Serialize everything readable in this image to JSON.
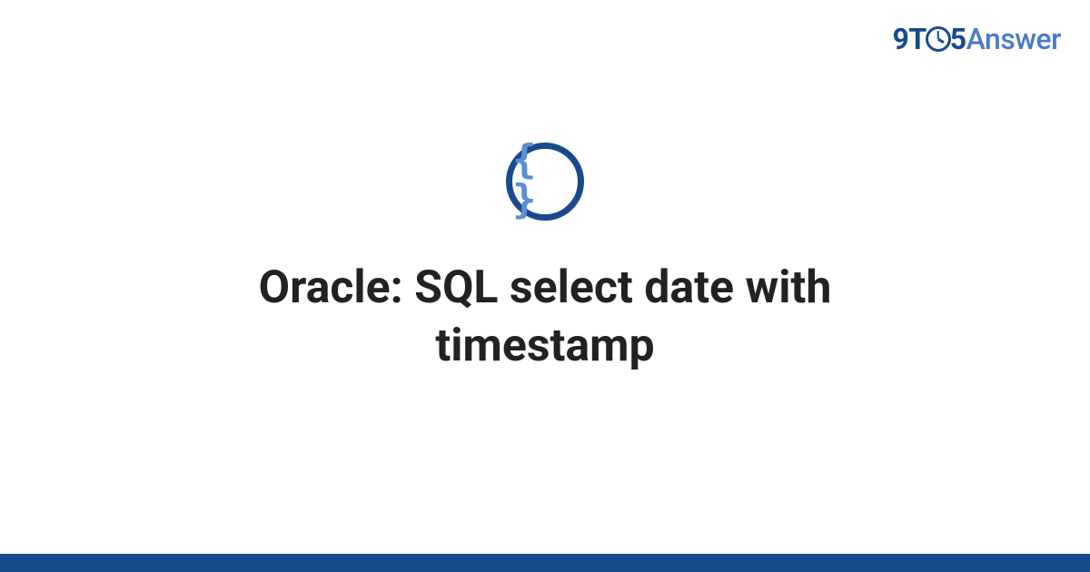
{
  "logo": {
    "prefix": "9T",
    "middle_digit": "5",
    "suffix": "Answer"
  },
  "topic_icon": {
    "glyph": "{ }",
    "semantic": "code-braces"
  },
  "title": "Oracle: SQL select date with timestamp",
  "colors": {
    "brand_dark": "#184a8c",
    "brand_light": "#4a7bc8",
    "icon_braces": "#5a8fd6",
    "text": "#222222",
    "background": "#ffffff"
  }
}
